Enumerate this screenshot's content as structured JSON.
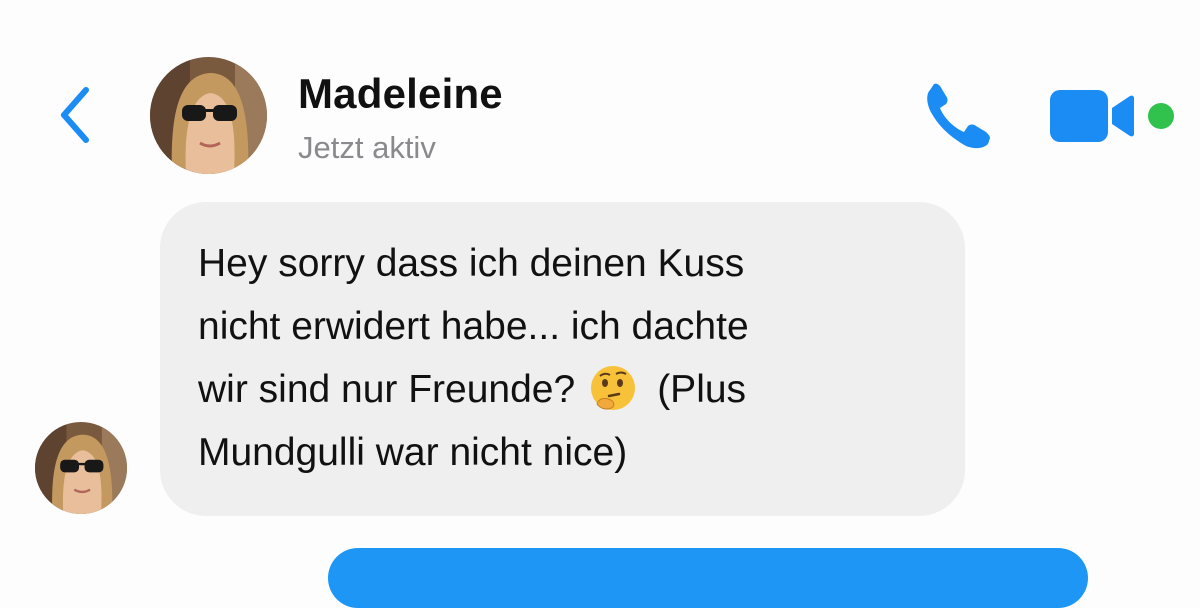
{
  "header": {
    "contact_name": "Madeleine",
    "status": "Jetzt aktiv",
    "back_icon": "chevron-left-icon",
    "call_icon": "phone-icon",
    "video_icon": "video-camera-icon",
    "online_indicator_color": "#31c24d"
  },
  "colors": {
    "accent": "#1a8cf3",
    "incoming_bubble": "#efefef",
    "outgoing_bubble": "#1e96f5",
    "status_text": "#8a8a8e"
  },
  "messages": [
    {
      "direction": "incoming",
      "lines": [
        "Hey sorry dass ich deinen Kuss",
        "nicht erwidert habe... ich dachte",
        "wir sind nur Freunde?",
        "(Plus",
        "Mundgulli war nicht nice)"
      ],
      "emoji": "thinking-face-emoji"
    },
    {
      "direction": "outgoing",
      "lines": []
    }
  ]
}
